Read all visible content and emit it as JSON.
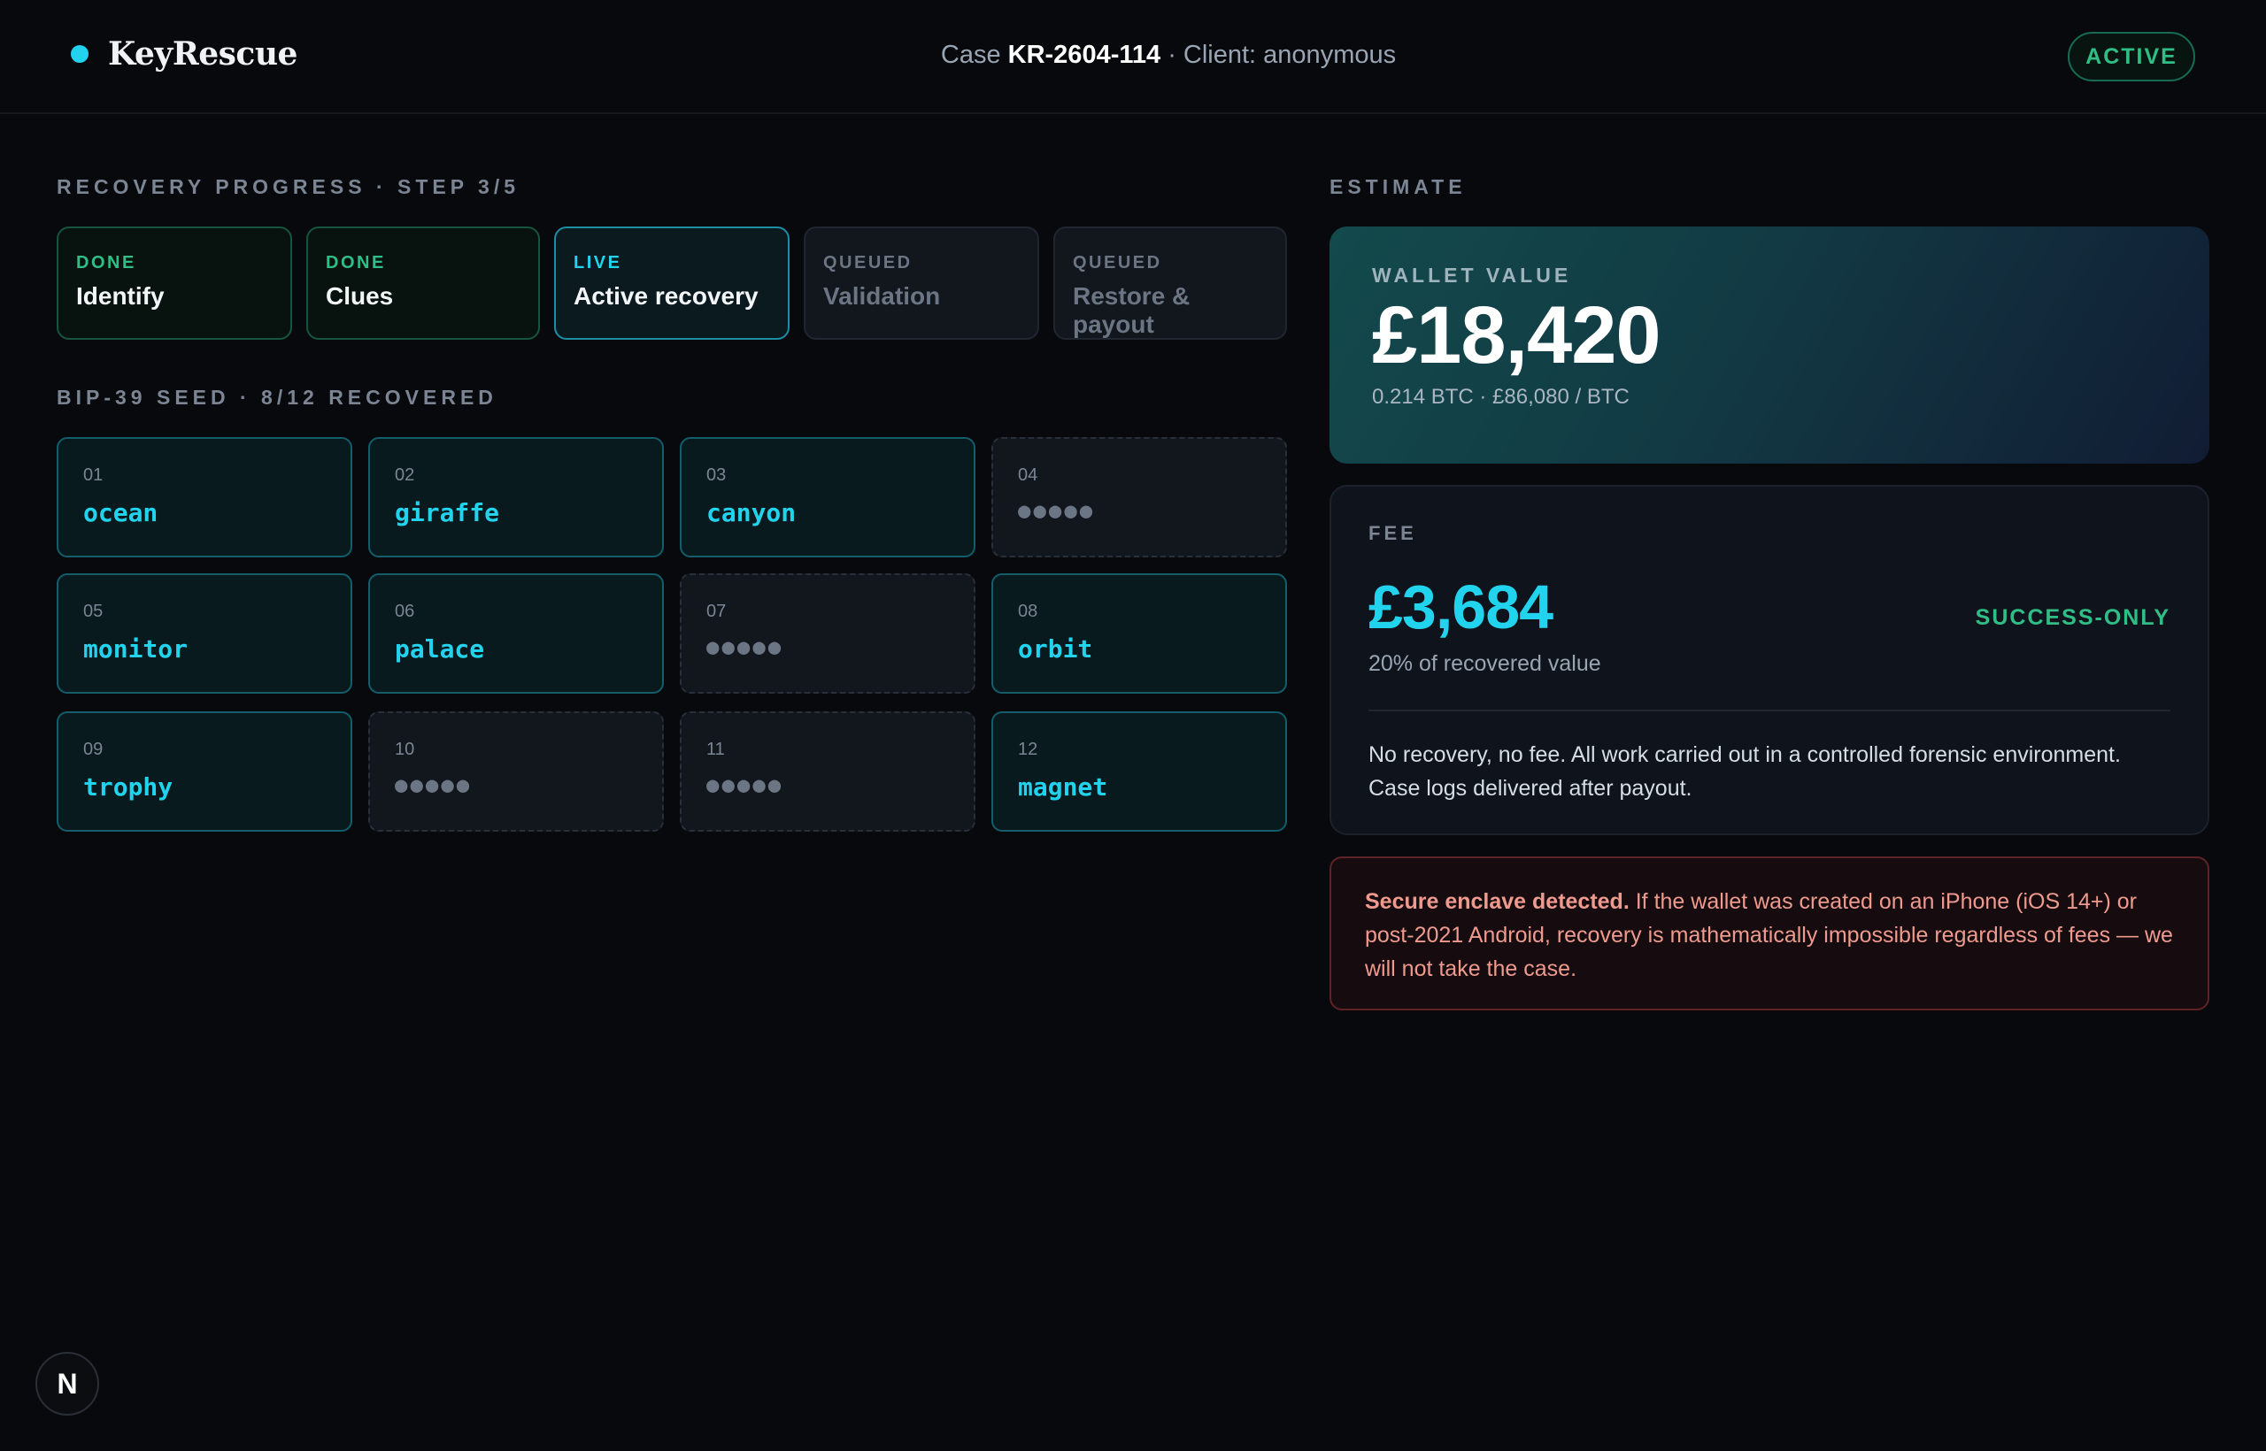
{
  "header": {
    "brand": "KeyRescue",
    "case_prefix": "Case",
    "case_id": "KR-2604-114",
    "client": "· Client: anonymous",
    "status_badge": "ACTIVE"
  },
  "progress": {
    "label": "RECOVERY PROGRESS · STEP 3/5",
    "steps": [
      {
        "status": "DONE",
        "title": "Identify"
      },
      {
        "status": "DONE",
        "title": "Clues"
      },
      {
        "status": "LIVE",
        "title": "Active recovery"
      },
      {
        "status": "QUEUED",
        "title": "Validation"
      },
      {
        "status": "QUEUED",
        "title": "Restore & payout"
      }
    ]
  },
  "seed": {
    "label": "BIP-39 SEED · 8/12 RECOVERED",
    "words": [
      {
        "index": "01",
        "word": "ocean"
      },
      {
        "index": "02",
        "word": "giraffe"
      },
      {
        "index": "03",
        "word": "canyon"
      },
      {
        "index": "04",
        "word": "●●●●●"
      },
      {
        "index": "05",
        "word": "monitor"
      },
      {
        "index": "06",
        "word": "palace"
      },
      {
        "index": "07",
        "word": "●●●●●"
      },
      {
        "index": "08",
        "word": "orbit"
      },
      {
        "index": "09",
        "word": "trophy"
      },
      {
        "index": "10",
        "word": "●●●●●"
      },
      {
        "index": "11",
        "word": "●●●●●"
      },
      {
        "index": "12",
        "word": "magnet"
      }
    ]
  },
  "estimate": {
    "label": "ESTIMATE",
    "wallet": {
      "label": "WALLET VALUE",
      "amount": "£18,420",
      "sub": "0.214 BTC · £86,080 / BTC"
    },
    "fee": {
      "label": "FEE",
      "amount": "£3,684",
      "terms": "SUCCESS-ONLY",
      "percent": "20% of recovered value",
      "note": "No recovery, no fee. All work carried out in a controlled forensic environment. Case logs delivered after payout."
    },
    "warning": {
      "bold": "Secure enclave detected.",
      "text": " If the wallet was created on an iPhone (iOS 14+) or post-2021 Android, recovery is mathematically impossible regardless of fees — we will not take the case."
    }
  },
  "dev_badge": "N",
  "colors": {
    "accent": "#22d3ee",
    "success": "#2fbf86",
    "background": "#07090d",
    "warning": "#ef9a8e"
  }
}
